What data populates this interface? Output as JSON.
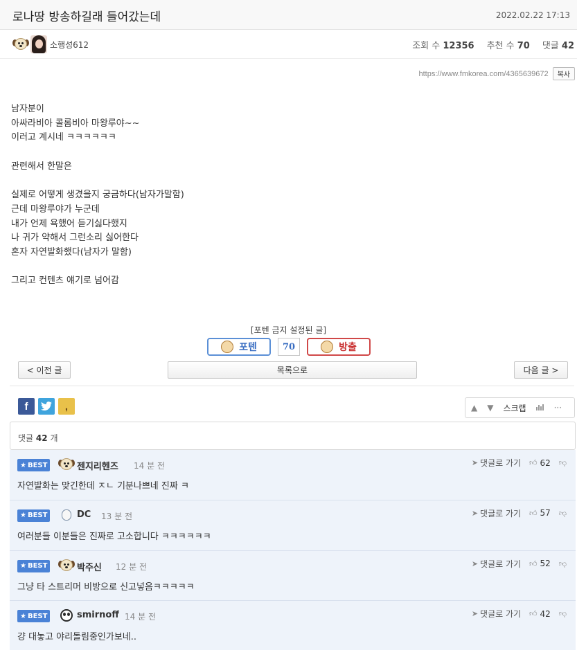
{
  "header": {
    "title": "로나땅 방송하길래 들어갔는데",
    "date": "2022.02.22 17:13"
  },
  "author": {
    "name": "소행성612",
    "avatar_icon": "dog-icon",
    "photo_icon": "profile-photo"
  },
  "stats": {
    "views_label": "조회 수",
    "views": "12356",
    "recommend_label": "추천 수",
    "recommend": "70",
    "comments_label": "댓글",
    "comments": "42"
  },
  "url": {
    "text": "https://www.fmkorea.com/4365639672",
    "copy_label": "복사"
  },
  "article": {
    "lines": [
      "남자분이",
      "아싸라비아 콜롬비아 마왕루야~~",
      "이러고 계시네 ㅋㅋㅋㅋㅋㅋ",
      "",
      "관련해서 한말은",
      "",
      "실제로 어떻게 생겼을지 궁금하다(남자가말함)",
      "근데 마왕루야가 누군데",
      "내가 언제 욕했어 듣기싫다했지",
      "나 귀가 약해서 그런소리 싫어한다",
      "혼자 자연발화했다(남자가 말함)",
      "",
      "그리고 컨텐츠 얘기로 넘어감"
    ]
  },
  "vote": {
    "notice": "[포텐 금지 설정된 글]",
    "up_label": "포텐",
    "count": "70",
    "down_label": "방출"
  },
  "nav": {
    "prev": "< 이전 글",
    "list": "목록으로",
    "next": "다음 글 >"
  },
  "tools": {
    "scrap": "스크랩"
  },
  "comment_box": {
    "label": "댓글",
    "count": "42",
    "unit": "개"
  },
  "comments": [
    {
      "badge": "BEST",
      "name": "젠지리헨즈",
      "time": "14 분 전",
      "text": "자연발화는 맞긴한데 ㅈㄴ 기분나쁘네 진짜 ㅋ",
      "goto": "댓글로 가기",
      "likes": "62",
      "avatar": "dog-icon"
    },
    {
      "badge": "BEST",
      "name": "DC",
      "time": "13 분 전",
      "text": "여러분들 이분들은 진짜로 고소합니다 ㅋㅋㅋㅋㅋㅋ",
      "goto": "댓글로 가기",
      "likes": "57",
      "avatar": "dc-avatar"
    },
    {
      "badge": "BEST",
      "name": "박주신",
      "time": "12 분 전",
      "text": "그냥 타 스트리머 비방으로 신고넣음ㅋㅋㅋㅋㅋ",
      "goto": "댓글로 가기",
      "likes": "52",
      "avatar": "dog-icon"
    },
    {
      "badge": "BEST",
      "name": "smirnoff",
      "time": "14 분 전",
      "text": "걍 대놓고 야리돌림중인가보네..",
      "goto": "댓글로 가기",
      "likes": "42",
      "avatar": "panda-icon"
    }
  ]
}
